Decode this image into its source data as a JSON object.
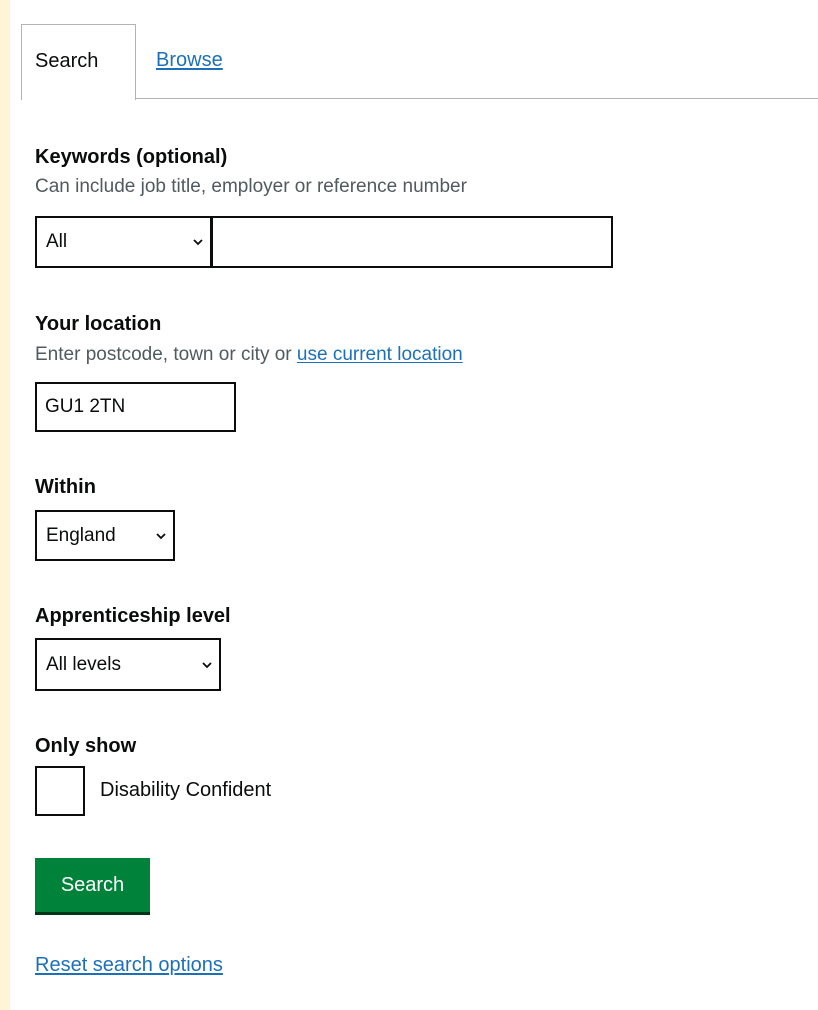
{
  "tabs": {
    "search_label": "Search",
    "browse_label": "Browse"
  },
  "keywords": {
    "label": "Keywords (optional)",
    "hint": "Can include job title, employer or reference number",
    "scope_selected": "All",
    "value": ""
  },
  "location": {
    "label": "Your location",
    "hint_prefix": "Enter postcode, town or city or ",
    "hint_link": "use current location",
    "value": "GU1 2TN"
  },
  "within": {
    "label": "Within",
    "selected": "England"
  },
  "level": {
    "label": "Apprenticeship level",
    "selected": "All levels"
  },
  "only_show": {
    "label": "Only show",
    "checkbox_label": "Disability Confident",
    "checked": false
  },
  "actions": {
    "search_label": "Search",
    "reset_label": "Reset search options"
  },
  "colors": {
    "page_background": "#fff4d6",
    "link": "#1d70b8",
    "button": "#00823b",
    "text": "#0b0c0c",
    "hint": "#505a5f"
  }
}
